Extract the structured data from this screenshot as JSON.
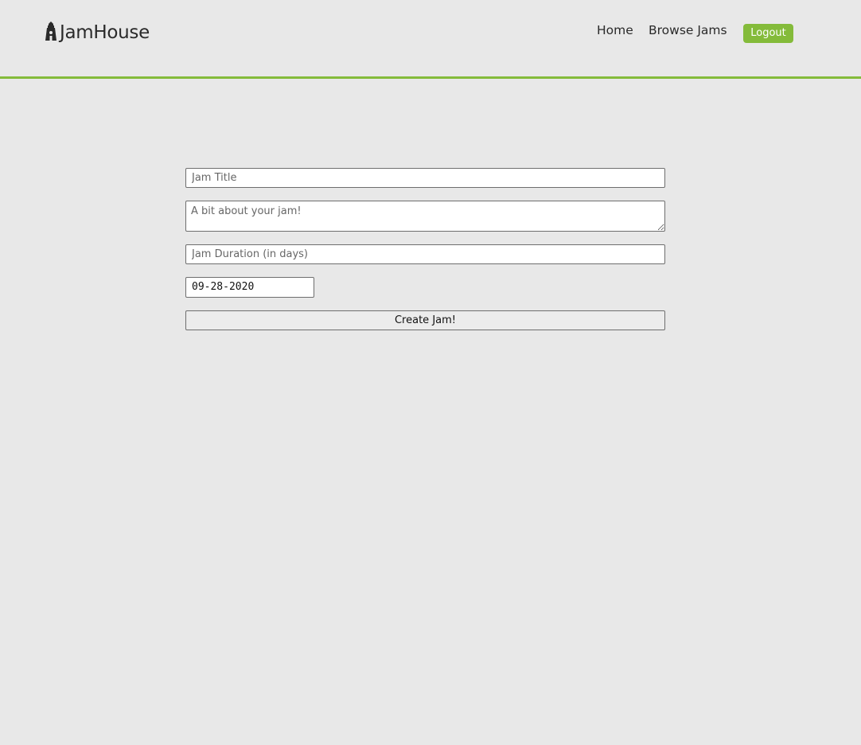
{
  "header": {
    "brand": "JamHouse",
    "logo_icon": "lighthouse-icon",
    "accent_color": "#84bb3a",
    "nav": {
      "home_label": "Home",
      "browse_label": "Browse Jams",
      "logout_label": "Logout"
    }
  },
  "form": {
    "title_placeholder": "Jam Title",
    "title_value": "",
    "description_placeholder": "A bit about your jam!",
    "description_value": "",
    "duration_placeholder": "Jam Duration (in days)",
    "duration_value": "",
    "date_value": "09-28-2020",
    "submit_label": "Create Jam!"
  }
}
